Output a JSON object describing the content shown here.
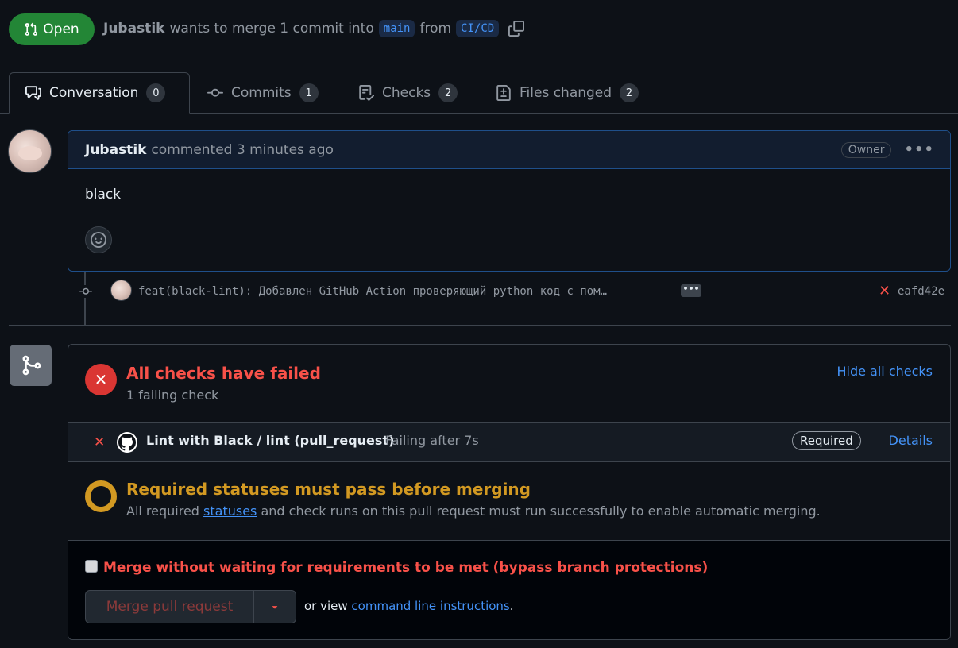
{
  "header": {
    "state": "Open",
    "author": "Jubastik",
    "action_text": "wants to merge 1 commit into",
    "base_branch": "main",
    "from_text": "from",
    "head_branch": "CI/CD"
  },
  "tabs": [
    {
      "label": "Conversation",
      "count": "0"
    },
    {
      "label": "Commits",
      "count": "1"
    },
    {
      "label": "Checks",
      "count": "2"
    },
    {
      "label": "Files changed",
      "count": "2"
    }
  ],
  "comment": {
    "author": "Jubastik",
    "meta": "commented 3 minutes ago",
    "role": "Owner",
    "more": "•••",
    "body": "black"
  },
  "commit": {
    "message": "feat(black-lint): Добавлен GitHub Action проверяющий python код с пом…",
    "more": "•••",
    "status_mark": "✕",
    "sha": "eafd42e"
  },
  "checks": {
    "status_mark": "✕",
    "title": "All checks have failed",
    "subtitle": "1 failing check",
    "hide_link": "Hide all checks",
    "items": [
      {
        "mark": "✕",
        "name": "Lint with Black / lint (pull_request)",
        "status": "Failing after 7s",
        "badge": "Required",
        "link": "Details"
      }
    ]
  },
  "requirements": {
    "title": "Required statuses must pass before merging",
    "text_before": "All required ",
    "link": "statuses",
    "text_after": " and check runs on this pull request must run successfully to enable automatic merging."
  },
  "merge": {
    "bypass_label": "Merge without waiting for requirements to be met (bypass branch protections)",
    "button_label": "Merge pull request",
    "or_view": "or view ",
    "cli_link": "command line instructions",
    "period": "."
  },
  "colors": {
    "open": "#238636",
    "danger": "#f85149",
    "attention": "#d29922",
    "accent": "#4493f8",
    "bg": "#0d1117"
  }
}
